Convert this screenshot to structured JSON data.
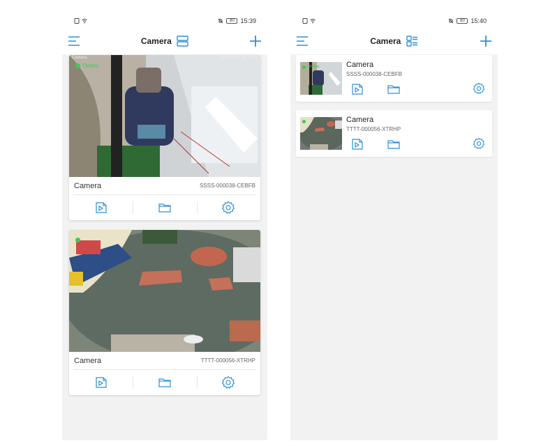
{
  "screens": [
    {
      "status": {
        "time": "15:39",
        "battery": "80"
      },
      "title": "Camera",
      "view_mode": "grid",
      "cameras": [
        {
          "name": "Camera",
          "id": "SSSS-000038-CEBFB",
          "status": "Online",
          "thumb_label": "Camera",
          "timestamp": "2020-03-05 15:38:41"
        },
        {
          "name": "Camera",
          "id": "TTTT-000056-XTRHP",
          "status": "Online"
        }
      ]
    },
    {
      "status": {
        "time": "15:40",
        "battery": "80"
      },
      "title": "Camera",
      "view_mode": "list",
      "cameras": [
        {
          "name": "Camera",
          "id": "SSSS-000038-CEBFB",
          "status": "Online"
        },
        {
          "name": "Camera",
          "id": "TTTT-000056-XTRHP",
          "status": "Online"
        }
      ]
    }
  ],
  "icons": {
    "menu": "menu-icon",
    "add": "plus-icon",
    "grid_view": "grid-view-icon",
    "list_view": "list-view-icon",
    "playback": "playback-icon",
    "folder": "folder-icon",
    "settings": "gear-icon"
  },
  "colors": {
    "accent": "#2e8fd6",
    "online": "#3ec95a"
  }
}
